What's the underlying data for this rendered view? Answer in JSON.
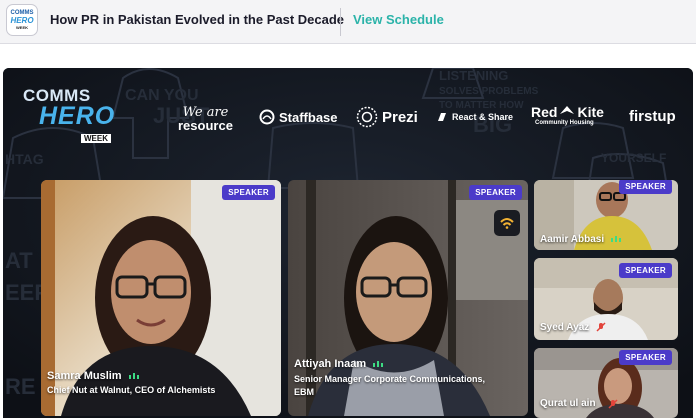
{
  "app": {
    "logo_line1": "COMMS",
    "logo_line2": "HERO",
    "logo_line3": "WEEK"
  },
  "header": {
    "title": "How PR in Pakistan Evolved in the Past Decade",
    "view_schedule_label": "View Schedule"
  },
  "event_brand": {
    "line1": "COMMS",
    "line2": "HERO",
    "line3": "WEEK"
  },
  "sponsors": {
    "we_are_resource_1": "We are",
    "we_are_resource_2": "resource",
    "staffbase": "Staffbase",
    "prezi": "Prezi",
    "react_share": "React & Share",
    "red_kite_1": "Red",
    "red_kite_2": "Kite",
    "red_kite_sub": "Community Housing",
    "firstup": "firstup"
  },
  "participants": [
    {
      "badge": "SPEAKER",
      "name": "Samra Muslim",
      "title": "Chief Nut at Walnut, CEO of Alchemists",
      "mic_active": true
    },
    {
      "badge": "SPEAKER",
      "name": "Attiyah Inaam",
      "title_line1": "Senior Manager Corporate Communications,",
      "title_line2": "EBM",
      "mic_active": true
    },
    {
      "badge": "SPEAKER",
      "name": "Aamir Abbasi",
      "mic_active": true
    },
    {
      "badge": "SPEAKER",
      "name": "Syed Ayaz",
      "mic_muted": true
    },
    {
      "badge": "SPEAKER",
      "name": "Qurat ul ain",
      "mic_muted": true
    }
  ],
  "colors": {
    "accent_teal": "#2bb3a9",
    "badge_purple": "#4b3bc9",
    "stage_bg": "#131821",
    "mic_active_green": "#3ddc84",
    "mic_muted_red": "#e2443b"
  }
}
